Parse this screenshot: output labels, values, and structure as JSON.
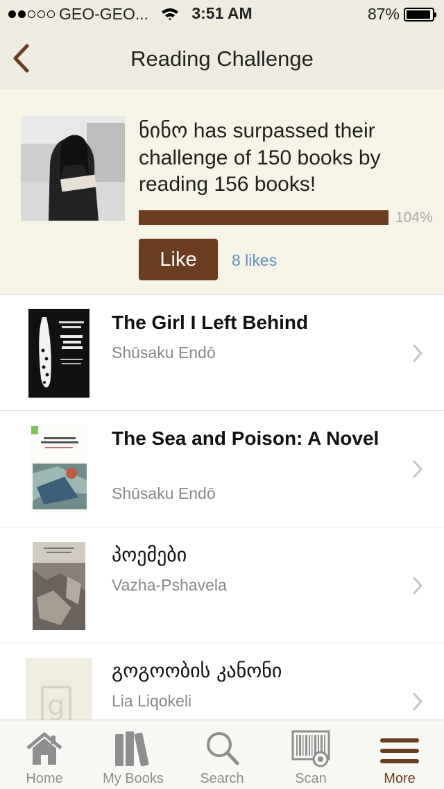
{
  "status_bar": {
    "carrier": "GEO-GEO...",
    "time": "3:51 AM",
    "battery": "87%"
  },
  "nav": {
    "title": "Reading Challenge"
  },
  "challenge": {
    "message": "ნინო has surpassed their challenge of 150 books by reading 156 books!",
    "progress_percent": 104,
    "progress_label": "104%",
    "like_label": "Like",
    "likes_label": "8 likes",
    "bar_color": "#6b3d1e"
  },
  "books": [
    {
      "title": "The Girl I Left Behind",
      "author": "Shūsaku Endō"
    },
    {
      "title": "The Sea and Poison: A Novel",
      "author": "Shūsaku Endō"
    },
    {
      "title": "პოემები",
      "author": "Vazha-Pshavela"
    },
    {
      "title": "გოგოობის კანონი",
      "author": "Lia Liqokeli"
    }
  ],
  "tabs": [
    {
      "label": "Home",
      "icon": "home-icon"
    },
    {
      "label": "My Books",
      "icon": "books-icon"
    },
    {
      "label": "Search",
      "icon": "search-icon"
    },
    {
      "label": "Scan",
      "icon": "barcode-scan-icon"
    },
    {
      "label": "More",
      "icon": "menu-icon",
      "active": true
    }
  ],
  "colors": {
    "accent": "#6b3d1e",
    "link": "#5f8fc0",
    "header_bg": "#eeece0"
  }
}
